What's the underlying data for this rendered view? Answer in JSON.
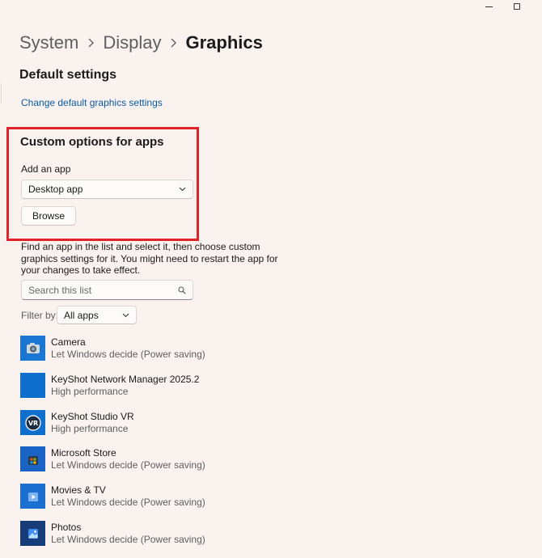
{
  "breadcrumb": [
    "System",
    "Display",
    "Graphics"
  ],
  "default_settings": {
    "title": "Default settings",
    "link": "Change default graphics settings"
  },
  "custom_options": {
    "title": "Custom options for apps",
    "add_label": "Add an app",
    "app_type": "Desktop app",
    "browse_label": "Browse"
  },
  "info_text": "Find an app in the list and select it, then choose custom graphics settings for it. You might need to restart the app for your changes to take effect.",
  "search": {
    "placeholder": "Search this list"
  },
  "filter": {
    "label": "Filter by:",
    "value": "All apps"
  },
  "apps": [
    {
      "name": "Camera",
      "preference": "Let Windows decide (Power saving)",
      "icon": "camera-icon"
    },
    {
      "name": "KeyShot Network Manager 2025.2",
      "preference": "High performance",
      "icon": "keyshot-network-icon"
    },
    {
      "name": "KeyShot Studio VR",
      "preference": "High performance",
      "icon": "keyshot-vr-icon"
    },
    {
      "name": "Microsoft Store",
      "preference": "Let Windows decide (Power saving)",
      "icon": "store-icon"
    },
    {
      "name": "Movies & TV",
      "preference": "Let Windows decide (Power saving)",
      "icon": "movies-icon"
    },
    {
      "name": "Photos",
      "preference": "Let Windows decide (Power saving)",
      "icon": "photos-icon"
    }
  ],
  "colors": {
    "background": "#f9f2ef",
    "link": "#0b5aa3",
    "highlight": "#e02328",
    "app_icon": "#0f6fce"
  }
}
